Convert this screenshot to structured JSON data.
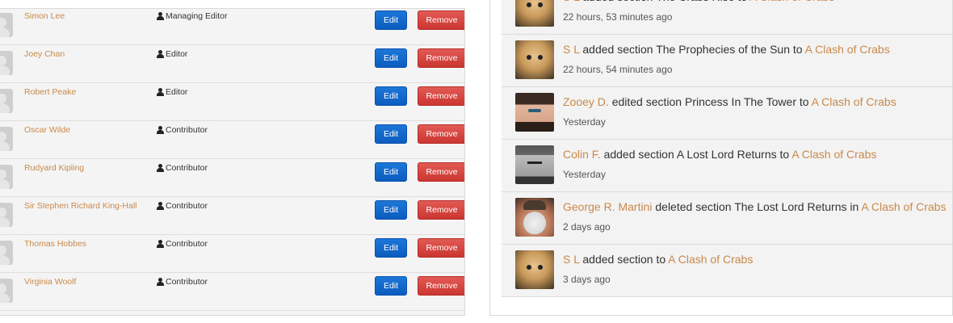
{
  "team": {
    "edit_label": "Edit",
    "remove_label": "Remove",
    "members": [
      {
        "name": "Simon Lee",
        "role": "Managing Editor"
      },
      {
        "name": "Joey Chan",
        "role": "Editor"
      },
      {
        "name": "Robert Peake",
        "role": "Editor"
      },
      {
        "name": "Oscar Wilde",
        "role": "Contributor"
      },
      {
        "name": "Rudyard Kipling",
        "role": "Contributor"
      },
      {
        "name": "Sir Stephen Richard King-Hall",
        "role": "Contributor"
      },
      {
        "name": "Thomas Hobbes",
        "role": "Contributor"
      },
      {
        "name": "Virginia Woolf",
        "role": "Contributor"
      }
    ]
  },
  "activity": {
    "items": [
      {
        "actor": "S L",
        "action": "added section The Crabs Rise to",
        "book": "A Clash of Crabs",
        "time": "22 hours, 53 minutes ago",
        "avatar": "cat"
      },
      {
        "actor": "S L",
        "action": "added section The Prophecies of the Sun to",
        "book": "A Clash of Crabs",
        "time": "22 hours, 54 minutes ago",
        "avatar": "cat"
      },
      {
        "actor": "Zooey D.",
        "action": "edited section Princess In The Tower to",
        "book": "A Clash of Crabs",
        "time": "Yesterday",
        "avatar": "zooey"
      },
      {
        "actor": "Colin F.",
        "action": "added section A Lost Lord Returns to",
        "book": "A Clash of Crabs",
        "time": "Yesterday",
        "avatar": "colin"
      },
      {
        "actor": "George R. Martini",
        "action": "deleted section The Lost Lord Returns in",
        "book": "A Clash of Crabs",
        "time": "2 days ago",
        "avatar": "george"
      },
      {
        "actor": "S L",
        "action": "added section to",
        "book": "A Clash of Crabs",
        "time": "3 days ago",
        "avatar": "cat"
      }
    ]
  }
}
